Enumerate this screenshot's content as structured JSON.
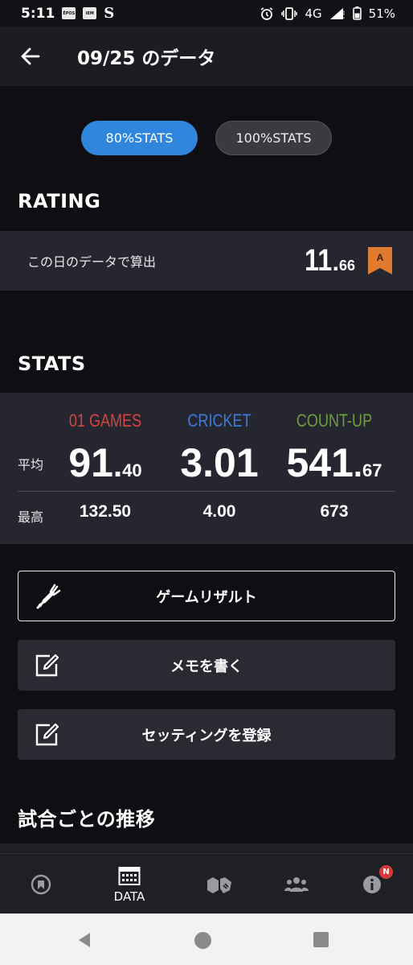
{
  "status_bar": {
    "time": "5:11",
    "badges": [
      "ĒPOS",
      "IEM"
    ],
    "app_icon": "S",
    "network": "4G",
    "battery": "51%"
  },
  "app_bar": {
    "title": "09/25 のデータ"
  },
  "toggle": {
    "options": [
      "80%STATS",
      "100%STATS"
    ],
    "selected": "80%STATS"
  },
  "rating": {
    "heading": "RATING",
    "label": "この日のデータで算出",
    "value_int": "11",
    "value_dec": "66",
    "rank": "A"
  },
  "stats": {
    "heading": "STATS",
    "columns": [
      "01 GAMES",
      "CRICKET",
      "COUNT-UP"
    ],
    "avg_label": "平均",
    "max_label": "最高",
    "avg": [
      {
        "int": "91",
        "dec": "40"
      },
      {
        "int": "3.01",
        "dec": ""
      },
      {
        "int": "541",
        "dec": "67"
      }
    ],
    "max": [
      "132.50",
      "4.00",
      "673"
    ]
  },
  "actions": {
    "game_result": "ゲームリザルト",
    "write_memo": "メモを書く",
    "register_setting": "セッティングを登録"
  },
  "trend": {
    "heading": "試合ごとの推移"
  },
  "bottom_nav": {
    "items": [
      "home-icon",
      "DATA",
      "friends-icon",
      "group-icon",
      "info-icon"
    ],
    "data_label": "DATA",
    "notification_badge": "N"
  },
  "colors": {
    "accent_blue": "#2f86dc",
    "games01": "#d24540",
    "cricket": "#3d7bd6",
    "countup": "#6e9d3e",
    "rank_badge": "#e07a2e"
  }
}
